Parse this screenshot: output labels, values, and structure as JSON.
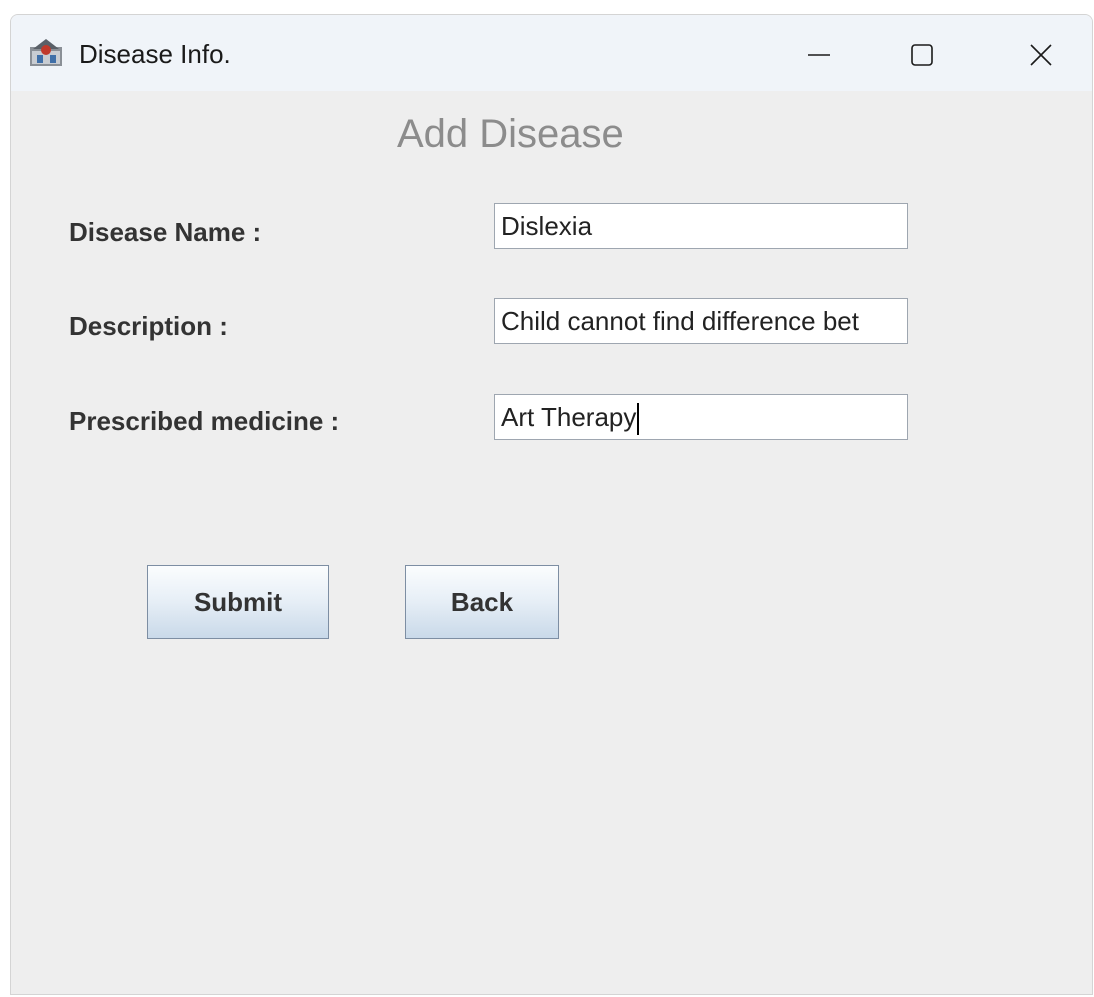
{
  "window": {
    "title": "Disease Info.",
    "icon": "java-app-icon",
    "controls": {
      "minimize_icon": "minimize-icon",
      "maximize_icon": "maximize-icon",
      "close_icon": "close-icon"
    }
  },
  "form": {
    "heading": "Add Disease",
    "fields": [
      {
        "label": "Disease Name :",
        "value": "Dislexia"
      },
      {
        "label": "Description :",
        "value": "Child cannot find difference bet"
      },
      {
        "label": "Prescribed medicine :",
        "value": "Art Therapy"
      }
    ]
  },
  "buttons": {
    "submit_label": "Submit",
    "back_label": "Back"
  },
  "colors": {
    "heading": "#8c8c8c",
    "label": "#333333",
    "background": "#eeeeee",
    "titlebar": "#f0f4f9"
  }
}
